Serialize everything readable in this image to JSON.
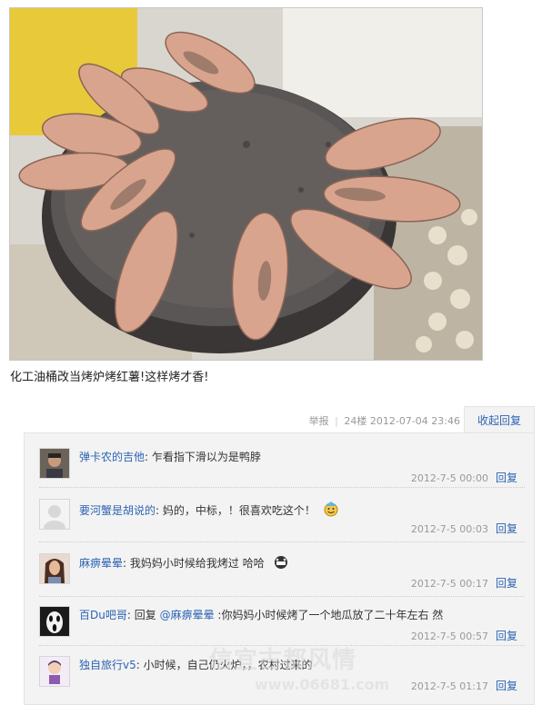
{
  "post": {
    "caption": "化工油桶改当烤炉烤红薯!这样烤才香!",
    "report_label": "举报",
    "floor": "24楼",
    "timestamp": "2012-07-04 23:46",
    "collapse_reply_label": "收起回复"
  },
  "comments": [
    {
      "user": "弹卡农的吉他",
      "text": "乍看指下滑以为是鸭脖",
      "time": "2012-7-5 00:00",
      "reply_label": "回复",
      "avatar": "portrait-man-avatar"
    },
    {
      "user": "要河蟹是胡说的",
      "text": "妈的，中标，！很喜欢吃这个！",
      "time": "2012-7-5 00:03",
      "reply_label": "回复",
      "avatar": "default-avatar",
      "emoticon": "smiley-emoticon"
    },
    {
      "user": "麻痹晕晕",
      "text": "我妈妈小时候给我烤过 哈哈",
      "time": "2012-7-5 00:17",
      "reply_label": "回复",
      "avatar": "portrait-woman-avatar",
      "emoticon": "grin-emoticon"
    },
    {
      "user": "百Du吧哥",
      "prefix": "回复",
      "mention": "@麻痹晕晕",
      "text": ":你妈妈小时候烤了一个地瓜放了二十年左右 然",
      "time": "2012-7-5 00:57",
      "reply_label": "回复",
      "avatar": "mask-avatar"
    },
    {
      "user": "独自旅行v5",
      "text": "小时候，自己仍火炉，，农村过来的",
      "time": "2012-7-5 01:17",
      "reply_label": "回复",
      "avatar": "cartoon-avatar"
    }
  ],
  "watermark": {
    "top": "信宜古都风情",
    "bottom": "www.06681.com"
  }
}
